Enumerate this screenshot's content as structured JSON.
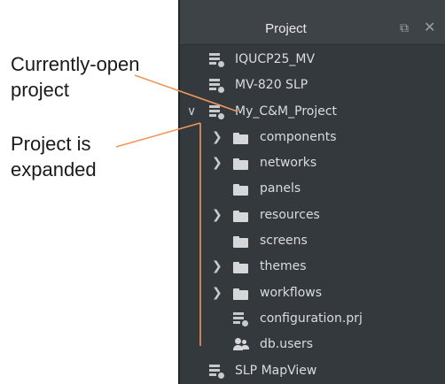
{
  "annotations": {
    "currently_open": [
      "Currently-open",
      "project"
    ],
    "expanded": [
      "Project is",
      "expanded"
    ]
  },
  "panel": {
    "title": "Project",
    "undock_icon": "undock-icon",
    "close_icon": "close-icon"
  },
  "tree": {
    "projects_before": [
      "IQUCP25_MV",
      "MV-820 SLP"
    ],
    "open_project": {
      "label": "My_C&M_Project",
      "expanded": true,
      "children": [
        {
          "label": "components",
          "icon": "folder-icon",
          "expandable": true
        },
        {
          "label": "networks",
          "icon": "folder-icon",
          "expandable": true
        },
        {
          "label": "panels",
          "icon": "folder-icon",
          "expandable": false
        },
        {
          "label": "resources",
          "icon": "folder-icon",
          "expandable": true
        },
        {
          "label": "screens",
          "icon": "folder-icon",
          "expandable": false
        },
        {
          "label": "themes",
          "icon": "folder-icon",
          "expandable": true
        },
        {
          "label": "workflows",
          "icon": "folder-icon",
          "expandable": true
        },
        {
          "label": "configuration.prj",
          "icon": "project-file-icon",
          "expandable": false
        },
        {
          "label": "db.users",
          "icon": "users-icon",
          "expandable": false
        }
      ]
    },
    "projects_after": [
      "SLP MapView"
    ]
  }
}
